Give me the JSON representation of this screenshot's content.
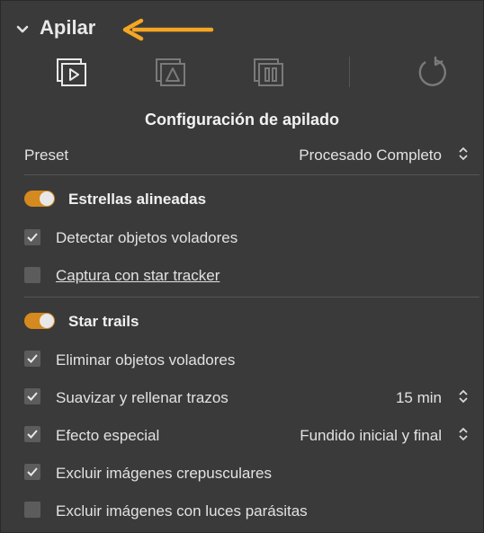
{
  "header": {
    "title": "Apilar"
  },
  "toolbar": {
    "buttons": [
      {
        "icon": "stack-play-icon",
        "state": "active"
      },
      {
        "icon": "stack-triangle-icon",
        "state": "inactive"
      },
      {
        "icon": "stack-pause-icon",
        "state": "inactive"
      },
      {
        "icon": "reset-icon",
        "state": "inactive"
      }
    ]
  },
  "section": {
    "title": "Configuración de apilado",
    "preset_label": "Preset",
    "preset_value": "Procesado Completo"
  },
  "aligned_stars": {
    "label": "Estrellas alineadas",
    "enabled": true,
    "options": [
      {
        "label": "Detectar objetos voladores",
        "checked": true
      },
      {
        "label": "Captura con star tracker",
        "checked": false
      }
    ]
  },
  "star_trails": {
    "label": "Star trails",
    "enabled": true,
    "options": [
      {
        "label": "Eliminar objetos voladores",
        "checked": true
      },
      {
        "label": "Suavizar y rellenar trazos",
        "checked": true,
        "value": "15 min"
      },
      {
        "label": "Efecto especial",
        "checked": true,
        "value": "Fundido inicial y final"
      },
      {
        "label": "Excluir imágenes crepusculares",
        "checked": true
      },
      {
        "label": "Excluir imágenes con luces parásitas",
        "checked": false
      }
    ]
  },
  "colors": {
    "accent": "#d48a1e",
    "arrow": "#f5a623",
    "background": "#3a3a3a"
  }
}
